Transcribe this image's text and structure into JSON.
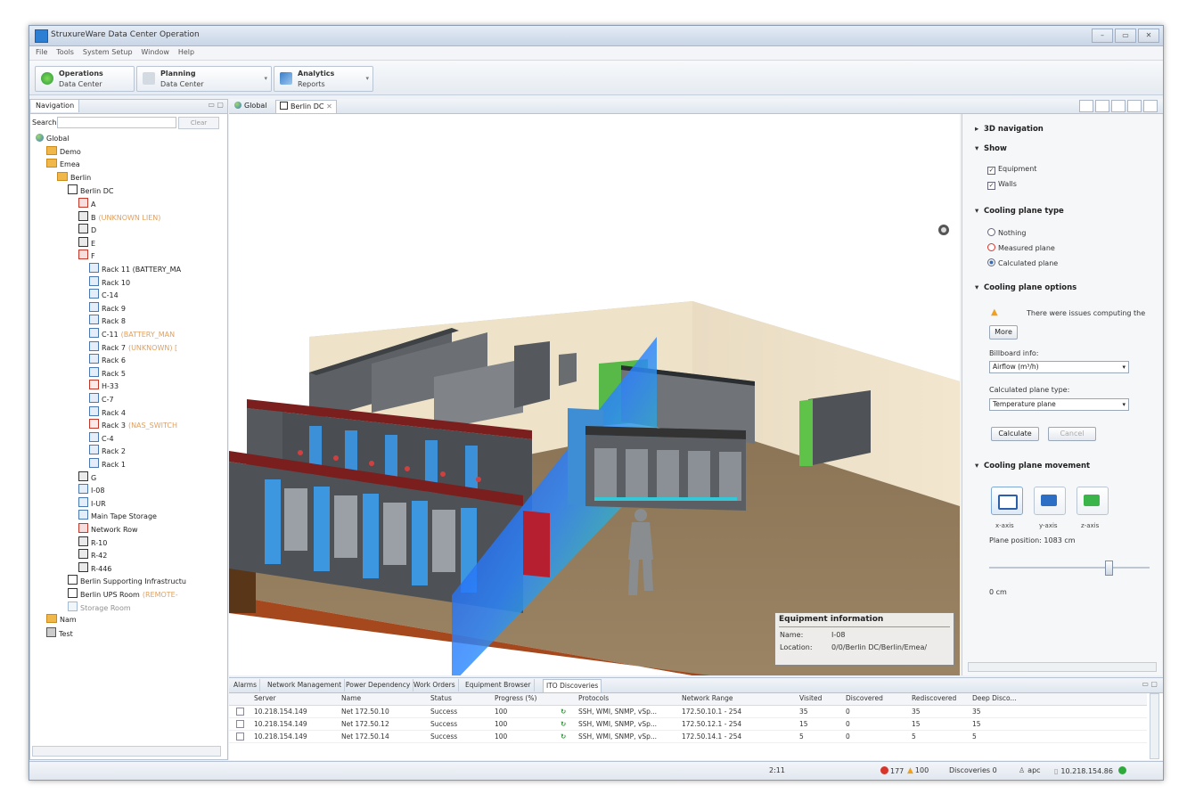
{
  "window": {
    "title": "StruxureWare Data Center Operation",
    "controls": [
      "–",
      "▭",
      "✕"
    ]
  },
  "menu": [
    "File",
    "Tools",
    "System Setup",
    "Window",
    "Help"
  ],
  "perspectives": [
    {
      "title": "Operations",
      "subtitle": "Data Center",
      "color": "#4caf50"
    },
    {
      "title": "Planning",
      "subtitle": "Data Center",
      "color": "#9aa6b2"
    },
    {
      "title": "Analytics",
      "subtitle": "Reports",
      "color": "#3a7dc8"
    }
  ],
  "navigation": {
    "tab": "Navigation",
    "search_label": "Search:",
    "search_value": "",
    "clear_label": "Clear",
    "tree": [
      {
        "label": "Global",
        "icon": "globe-icon",
        "level": 0
      },
      {
        "label": "Demo",
        "icon": "folder-icon",
        "level": 1
      },
      {
        "label": "Emea",
        "icon": "folder-icon",
        "level": 1
      },
      {
        "label": "Berlin",
        "icon": "folder-icon",
        "level": 2
      },
      {
        "label": "Berlin DC",
        "icon": "datacenter-icon",
        "level": 3
      },
      {
        "label": "A",
        "icon": "row-red-icon",
        "level": 4
      },
      {
        "label": "B",
        "note": "(UNKNOWN LIEN)",
        "icon": "row-icon",
        "level": 4
      },
      {
        "label": "D",
        "icon": "row-icon",
        "level": 4
      },
      {
        "label": "E",
        "icon": "row-icon",
        "level": 4
      },
      {
        "label": "F",
        "icon": "row-red-icon",
        "level": 4
      },
      {
        "label": "Rack 11 (BATTERY_MA",
        "icon": "rack-icon",
        "level": 5
      },
      {
        "label": "Rack 10",
        "icon": "rack-icon",
        "level": 5
      },
      {
        "label": "C-14",
        "icon": "rack-icon",
        "level": 5
      },
      {
        "label": "Rack 9",
        "icon": "rack-icon",
        "level": 5
      },
      {
        "label": "Rack 8",
        "icon": "rack-icon",
        "level": 5
      },
      {
        "label": "C-11",
        "note": "(BATTERY_MAN",
        "icon": "rack-icon",
        "level": 5
      },
      {
        "label": "Rack 7",
        "note": "(UNKNOWN) [",
        "icon": "rack-icon",
        "level": 5
      },
      {
        "label": "Rack 6",
        "icon": "rack-icon",
        "level": 5
      },
      {
        "label": "Rack 5",
        "icon": "rack-icon",
        "level": 5
      },
      {
        "label": "H-33",
        "icon": "rack-red-icon",
        "level": 5
      },
      {
        "label": "C-7",
        "icon": "rack-icon",
        "level": 5
      },
      {
        "label": "Rack 4",
        "icon": "rack-icon",
        "level": 5
      },
      {
        "label": "Rack 3",
        "note": "(NAS_SWITCH",
        "icon": "rack-red-icon",
        "level": 5
      },
      {
        "label": "C-4",
        "icon": "rack-icon",
        "level": 5
      },
      {
        "label": "Rack 2",
        "icon": "rack-icon",
        "level": 5
      },
      {
        "label": "Rack 1",
        "icon": "rack-icon",
        "level": 5
      },
      {
        "label": "G",
        "icon": "row-icon",
        "level": 4
      },
      {
        "label": "I-08",
        "icon": "rack-icon",
        "level": 4
      },
      {
        "label": "I-UR",
        "icon": "rack-icon",
        "level": 4
      },
      {
        "label": "Main Tape Storage",
        "icon": "rack-icon",
        "level": 4
      },
      {
        "label": "Network Row",
        "icon": "row-red-icon",
        "level": 4
      },
      {
        "label": "R-10",
        "icon": "row-icon",
        "level": 4
      },
      {
        "label": "R-42",
        "icon": "row-icon",
        "level": 4
      },
      {
        "label": "R-446",
        "icon": "row-icon",
        "level": 4
      },
      {
        "label": "Berlin Supporting Infrastructu",
        "icon": "datacenter-icon",
        "level": 3
      },
      {
        "label": "Berlin UPS Room",
        "note": "(REMOTE-",
        "icon": "datacenter-icon",
        "level": 3
      },
      {
        "label": "Storage Room",
        "icon": "room-icon",
        "level": 3,
        "faded": true
      },
      {
        "label": "Nam",
        "icon": "folder-icon",
        "level": 1
      },
      {
        "label": "Test",
        "icon": "network-icon",
        "level": 1
      }
    ]
  },
  "editor_tabs": [
    {
      "label": "Global",
      "icon": "globe-icon"
    },
    {
      "label": "Berlin DC",
      "icon": "datacenter-icon",
      "active": true
    }
  ],
  "right_panel": {
    "nav3d": "3D navigation",
    "show_header": "Show",
    "show_items": [
      {
        "label": "Equipment",
        "checked": true
      },
      {
        "label": "Walls",
        "checked": true
      }
    ],
    "cooling_type_header": "Cooling plane type",
    "cooling_types": [
      {
        "label": "Nothing",
        "selected": false
      },
      {
        "label": "Measured plane",
        "selected": false,
        "error": true
      },
      {
        "label": "Calculated plane",
        "selected": true
      }
    ],
    "cooling_options_header": "Cooling plane options",
    "warning_text": "There were issues computing the",
    "more_label": "More",
    "billboard_label": "Billboard info:",
    "billboard_value": "Airflow (m³/h)",
    "calc_type_label": "Calculated plane type:",
    "calc_type_value": "Temperature plane",
    "calculate_label": "Calculate",
    "cancel_label": "Cancel",
    "movement_header": "Cooling plane movement",
    "axes": [
      {
        "label": "x-axis"
      },
      {
        "label": "y-axis"
      },
      {
        "label": "z-axis"
      }
    ],
    "plane_position_label": "Plane position:",
    "plane_position_value": "1083",
    "plane_position_unit": "cm",
    "slider_min": "0 cm"
  },
  "equipment_info": {
    "header": "Equipment information",
    "name_key": "Name:",
    "name_value": "I-08",
    "location_key": "Location:",
    "location_value": "0/0/Berlin DC/Berlin/Emea/"
  },
  "bottom_tabs": [
    "Alarms",
    "Network Management",
    "Power Dependency",
    "Work Orders",
    "Equipment Browser",
    "ITO Discoveries"
  ],
  "table": {
    "columns": [
      "Server",
      "Name",
      "Status",
      "Progress (%)",
      "",
      "Protocols",
      "Network Range",
      "Visited",
      "Discovered",
      "Rediscovered",
      "Deep Disco..."
    ],
    "rows": [
      [
        "10.218.154.149",
        "Net 172.50.10",
        "Success",
        "100",
        "↻",
        "SSH, WMI, SNMP, vSp...",
        "172.50.10.1 - 254",
        "35",
        "0",
        "35",
        "35"
      ],
      [
        "10.218.154.149",
        "Net 172.50.12",
        "Success",
        "100",
        "↻",
        "SSH, WMI, SNMP, vSp...",
        "172.50.12.1 - 254",
        "15",
        "0",
        "15",
        "15"
      ],
      [
        "10.218.154.149",
        "Net 172.50.14",
        "Success",
        "100",
        "↻",
        "SSH, WMI, SNMP, vSp...",
        "172.50.14.1 - 254",
        "5",
        "0",
        "5",
        "5"
      ]
    ]
  },
  "status": {
    "position": "2:11",
    "errors": "177",
    "warnings": "100",
    "discoveries": "Discoveries 0",
    "user": "apc",
    "server": "10.218.154.86"
  },
  "colors": {
    "accent": "#2d7fd3",
    "error": "#d9342b",
    "warning": "#f0a020",
    "ok": "#2eaa3d"
  }
}
